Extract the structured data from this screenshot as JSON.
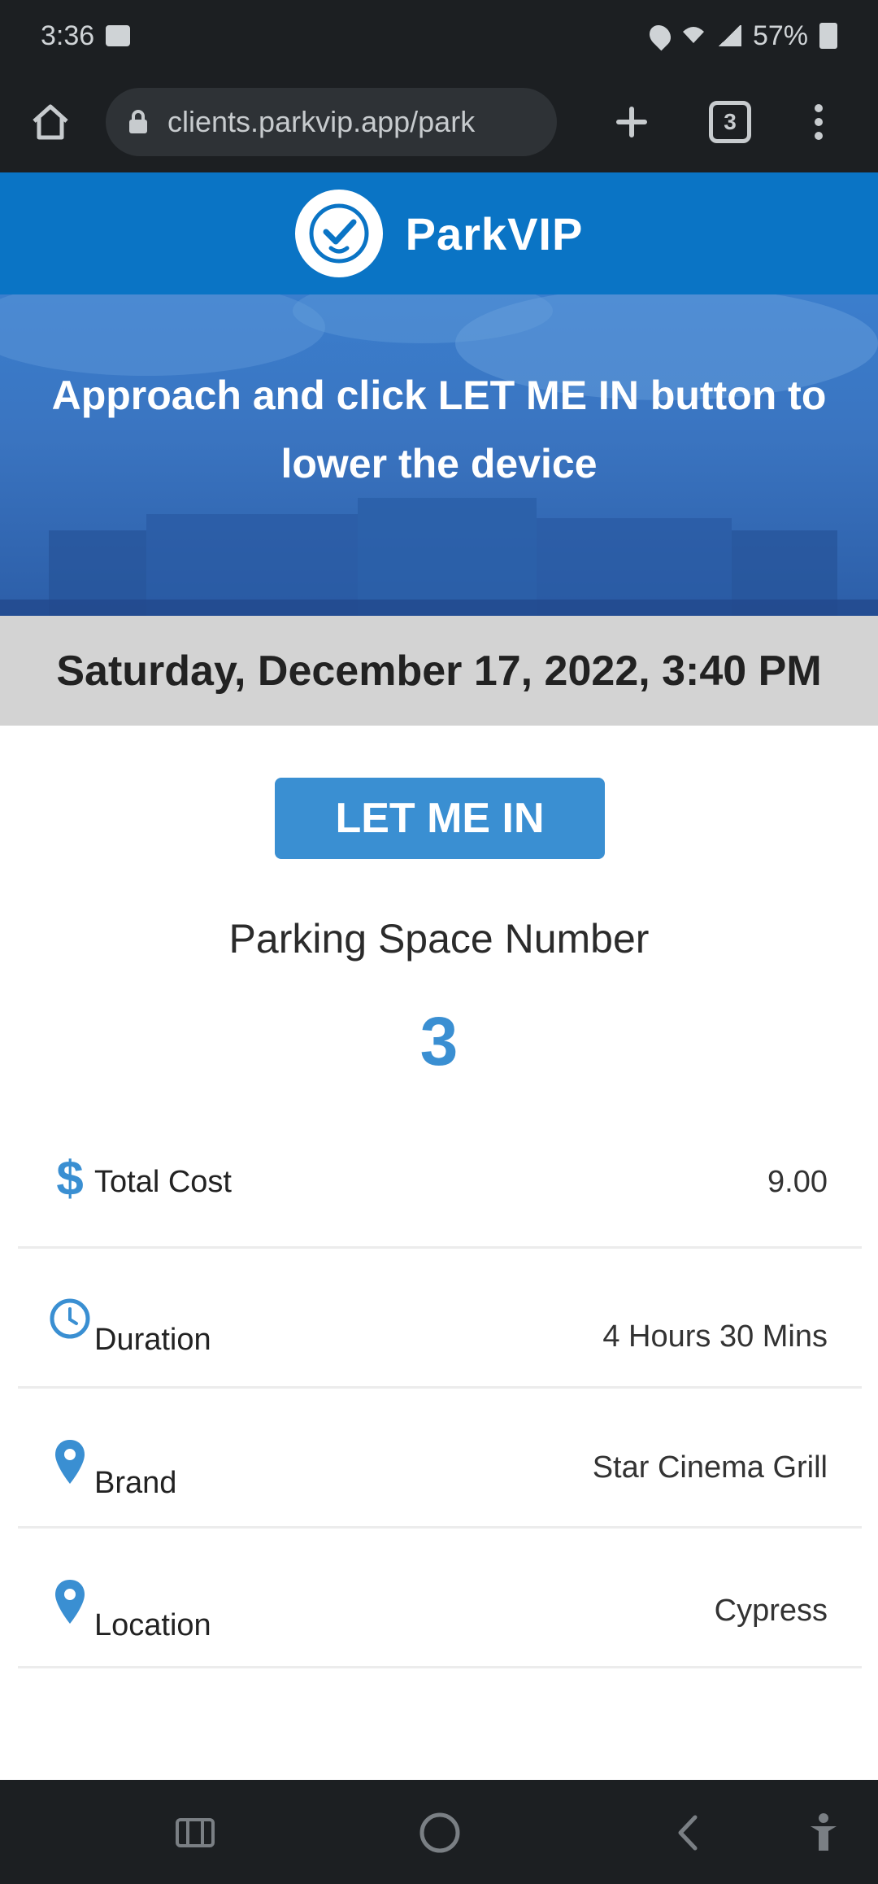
{
  "status_bar": {
    "time": "3:36",
    "battery": "57%",
    "icons": [
      "gallery-icon",
      "location-icon",
      "wifi-icon",
      "signal-icon",
      "battery-icon"
    ]
  },
  "browser": {
    "url": "clients.parkvip.app/park",
    "tab_count": "3",
    "icons": [
      "home-icon",
      "lock-icon",
      "plus-icon",
      "tabs-icon",
      "menu-icon"
    ]
  },
  "header": {
    "brand": "ParkVIP",
    "logo_icon": "parkvip-logo-icon",
    "bg_color": "#0a74c5"
  },
  "hero": {
    "message": "Approach and click LET ME IN button to lower the device"
  },
  "date_time": "Saturday, December 17, 2022, 3:40 PM",
  "cta": {
    "label": "LET ME IN",
    "color": "#3a8fd2"
  },
  "parking": {
    "label": "Parking Space Number",
    "number": "3"
  },
  "details": [
    {
      "icon": "dollar-icon",
      "label": "Total Cost",
      "value": "9.00"
    },
    {
      "icon": "clock-icon",
      "label": "Duration",
      "value": "4 Hours 30 Mins"
    },
    {
      "icon": "location-pin-icon",
      "label": "Brand",
      "value": "Star Cinema Grill"
    },
    {
      "icon": "location-pin-icon",
      "label": "Location",
      "value": "Cypress"
    }
  ],
  "nav_bar": {
    "icons": [
      "recent-apps-icon",
      "home-circle-icon",
      "back-icon",
      "accessibility-icon"
    ]
  }
}
